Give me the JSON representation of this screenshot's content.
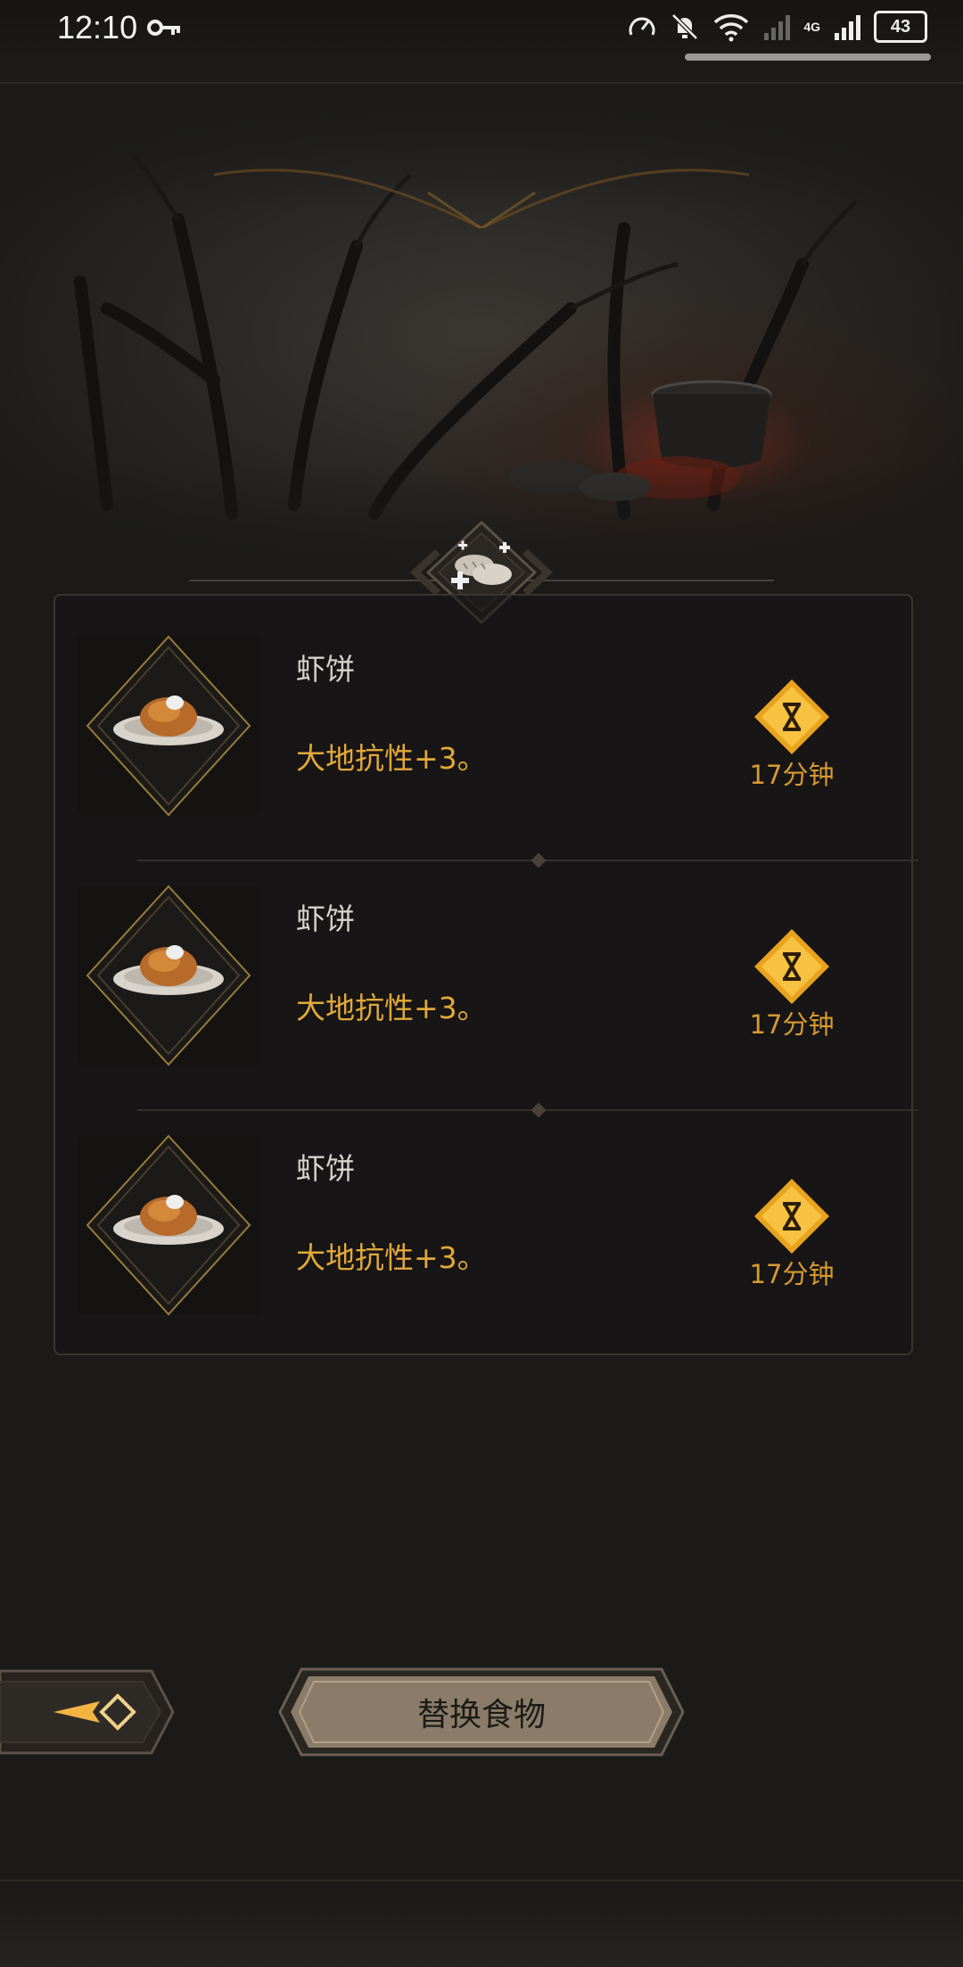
{
  "status_bar": {
    "time": "12:10",
    "battery": "43",
    "network_label": "4G"
  },
  "items": [
    {
      "name": "虾饼",
      "effect": "大地抗性+3。",
      "duration": "17分钟"
    },
    {
      "name": "虾饼",
      "effect": "大地抗性+3。",
      "duration": "17分钟"
    },
    {
      "name": "虾饼",
      "effect": "大地抗性+3。",
      "duration": "17分钟"
    }
  ],
  "actions": {
    "replace_label": "替换食物"
  },
  "colors": {
    "accent_gold": "#e2a93a",
    "timer_gold": "#d79a30",
    "button_bg": "#8a7c68"
  }
}
